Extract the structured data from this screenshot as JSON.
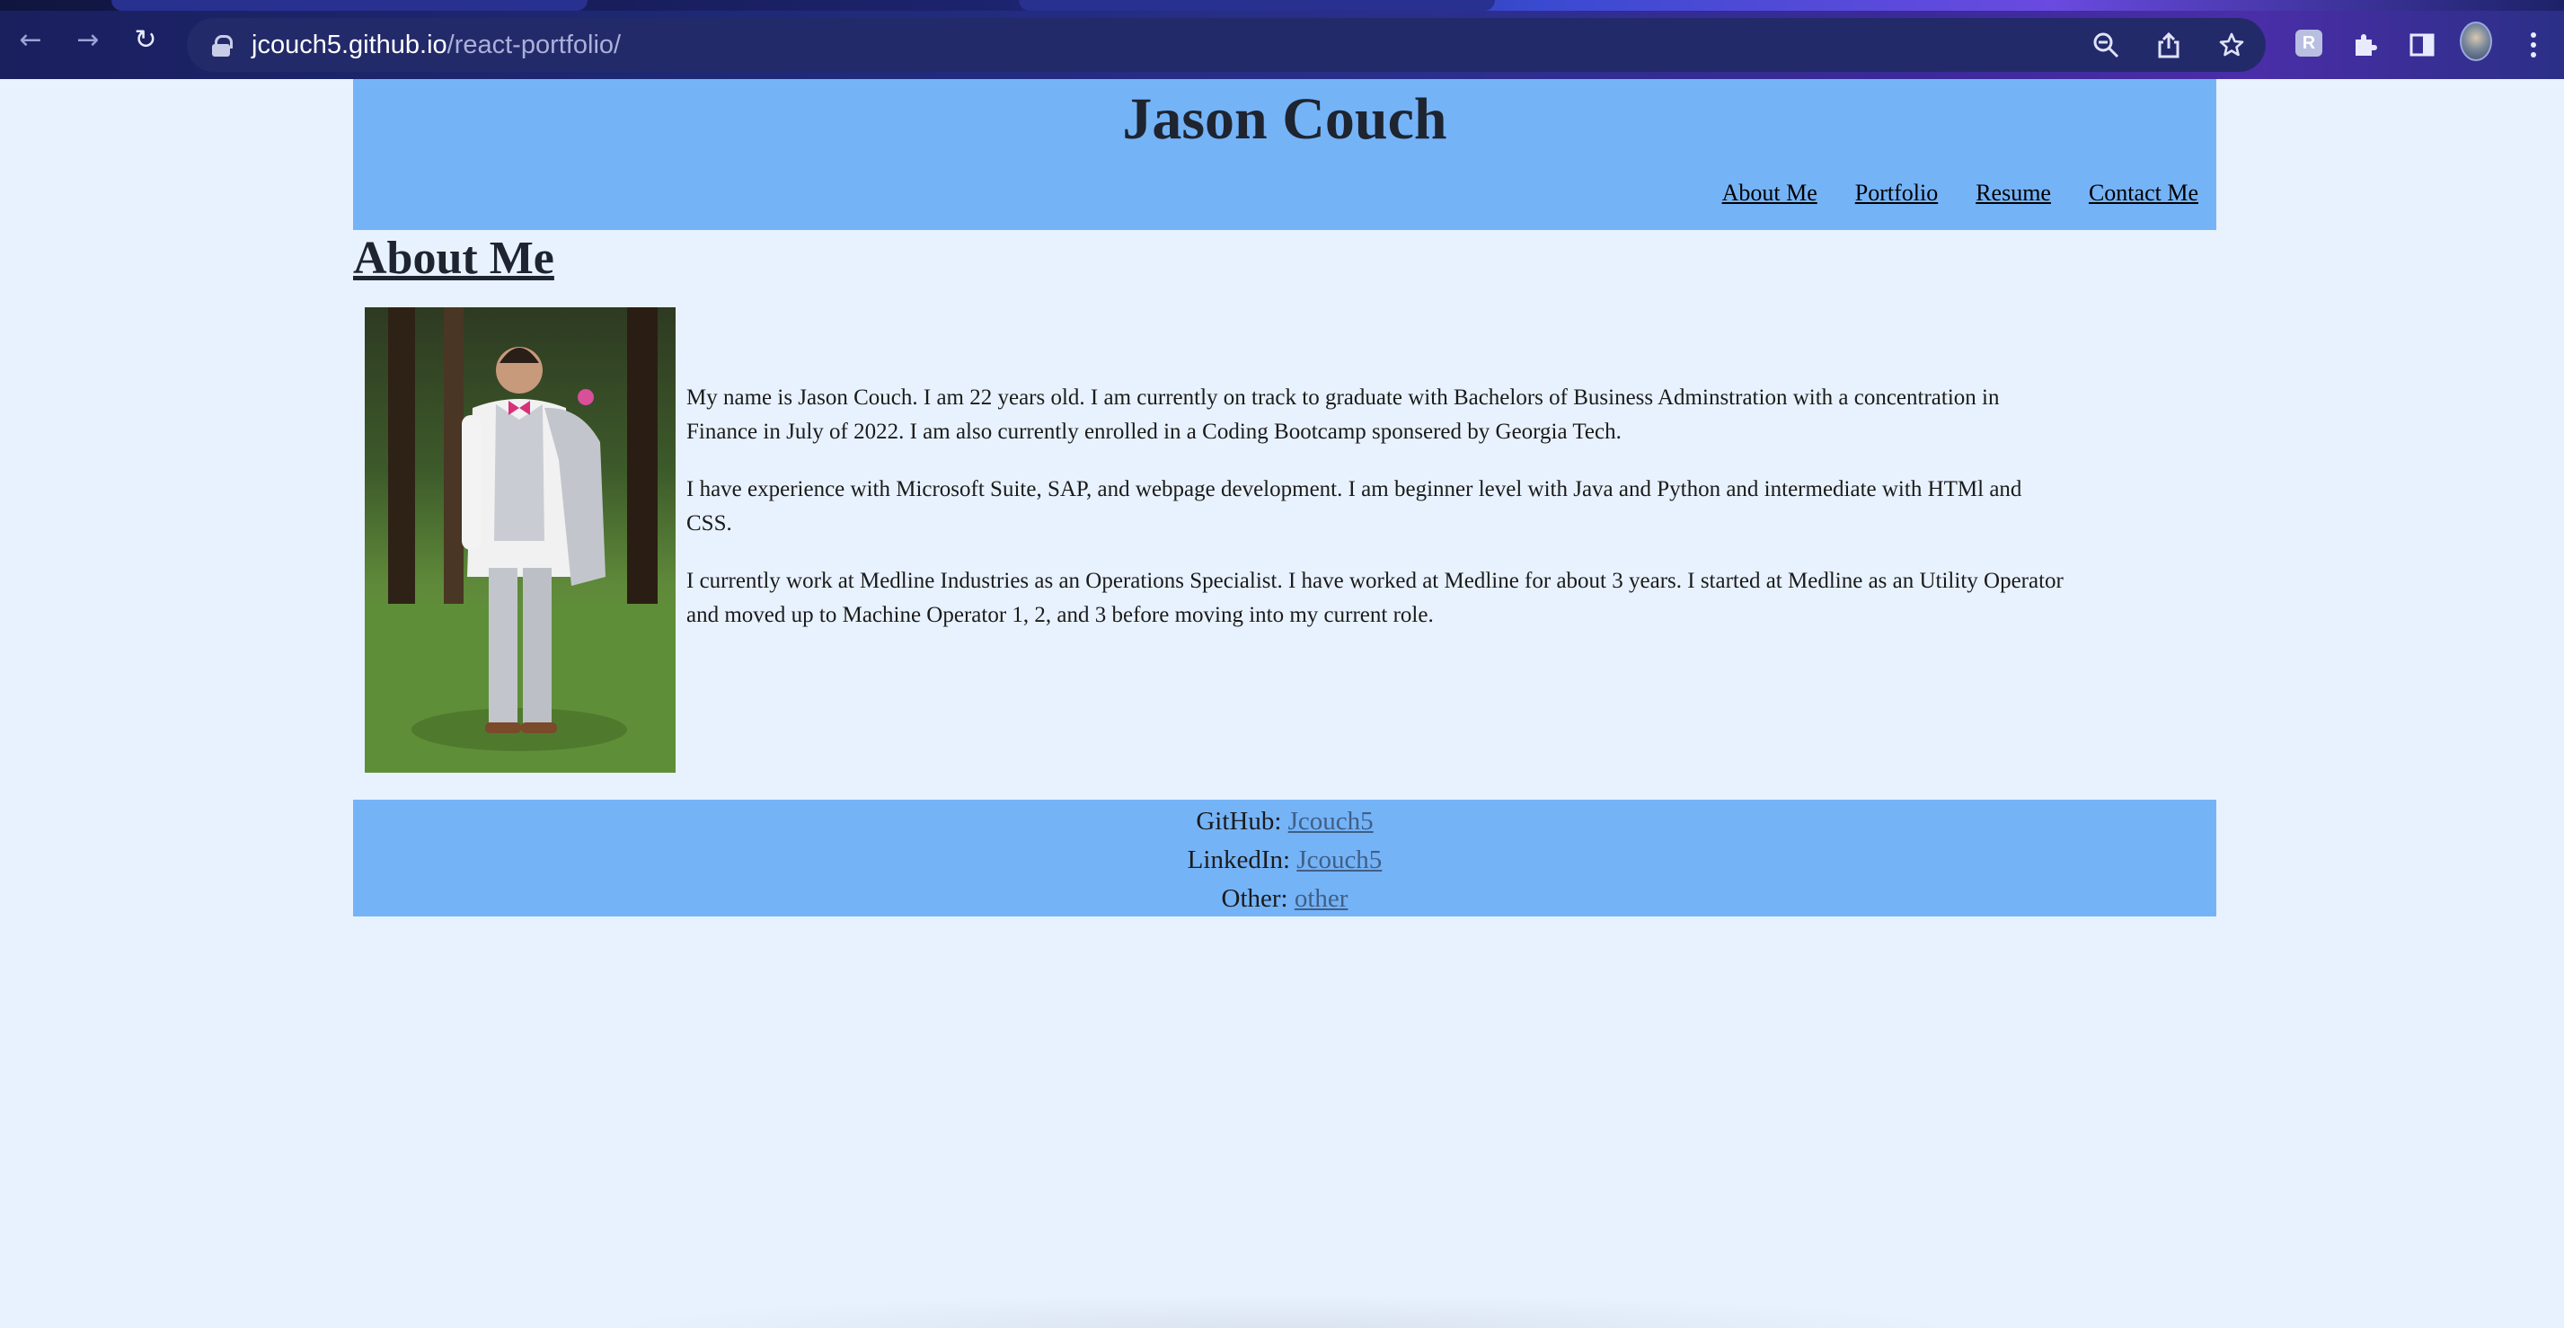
{
  "browser": {
    "url_host": "jcouch5.github.io",
    "url_path": "/react-portfolio/",
    "nav": {
      "back": "←",
      "forward": "→",
      "reload": "↻"
    },
    "omni_icons": [
      "zoom-icon",
      "share-icon",
      "star-icon"
    ],
    "extension_badge": "R",
    "toolbar_icons": [
      "extensions-icon",
      "side-panel-icon",
      "profile-avatar",
      "menu-icon"
    ]
  },
  "header": {
    "title": "Jason Couch",
    "nav": [
      "About Me",
      "Portfolio",
      "Resume",
      "Contact Me"
    ]
  },
  "about": {
    "heading": "About Me",
    "paragraphs": [
      "My name is Jason Couch. I am 22 years old. I am currently on track to graduate with Bachelors of Business Adminstration with a concentration in Finance in July of 2022. I am also currently enrolled in a Coding Bootcamp sponsered by Georgia Tech.",
      "I have experience with Microsoft Suite, SAP, and webpage development. I am beginner level with Java and Python and intermediate with HTMl and CSS.",
      "I currently work at Medline Industries as an Operations Specialist. I have worked at Medline for about 3 years. I started at Medline as an Utility Operator and moved up to Machine Operator 1, 2, and 3 before moving into my current role."
    ]
  },
  "footer": {
    "github_label": "GitHub: ",
    "github_link": "Jcouch5",
    "linkedin_label": "LinkedIn: ",
    "linkedin_link": "Jcouch5",
    "other_label": "Other: ",
    "other_link": "other"
  },
  "colors": {
    "page_bg": "#e8f2fe",
    "header_bg": "#75b3f7",
    "footer_link": "#3f5f86"
  }
}
